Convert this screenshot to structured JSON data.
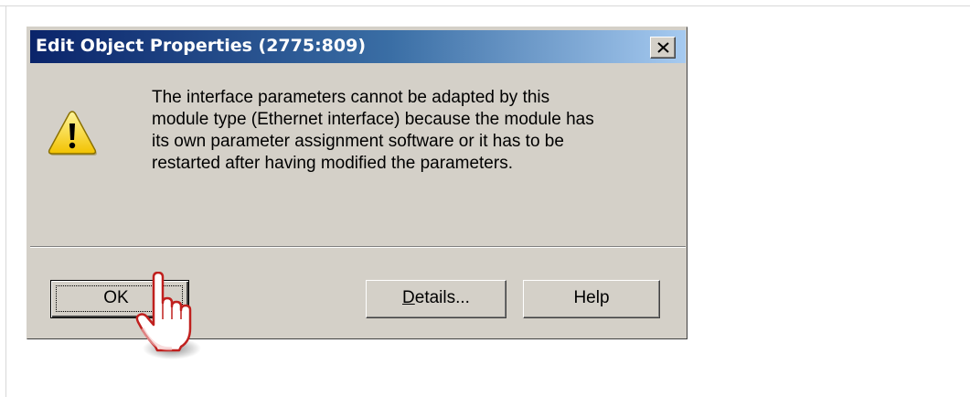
{
  "dialog": {
    "title": "Edit Object Properties (2775:809)",
    "close_glyph": "X",
    "icon": "warning-icon",
    "message_lines": [
      "The interface parameters cannot be adapted by this",
      "module type (Ethernet interface) because the module has",
      "its own parameter assignment software or it has to be",
      "restarted after having modified the parameters."
    ],
    "buttons": {
      "ok_label": "OK",
      "details_mnemonic": "D",
      "details_rest": "etails...",
      "help_label": "Help"
    }
  },
  "cursor": {
    "icon": "hand-pointer-icon"
  },
  "colors": {
    "titlebar_start": "#0a246a",
    "titlebar_end": "#a6caf0",
    "dialog_face": "#d4d0c8",
    "warning_yellow": "#f7d71c"
  }
}
